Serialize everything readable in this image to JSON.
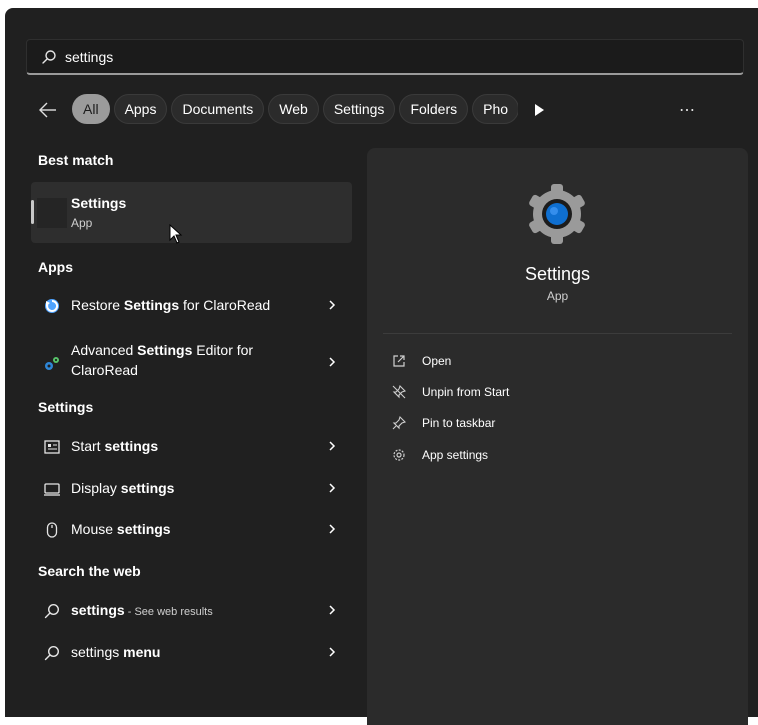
{
  "search": {
    "value": "settings"
  },
  "filters": [
    "All",
    "Apps",
    "Documents",
    "Web",
    "Settings",
    "Folders",
    "Pho"
  ],
  "sections": {
    "best_match": "Best match",
    "apps": "Apps",
    "settings": "Settings",
    "search_web": "Search the web"
  },
  "best_match": {
    "name": "Settings",
    "type": "App"
  },
  "apps": [
    {
      "pre": "Restore ",
      "bold": "Settings",
      "post": " for ClaroRead",
      "icon": "restore-icon"
    },
    {
      "pre": "Advanced ",
      "bold": "Settings",
      "post": " Editor for ClaroRead",
      "icon": "advanced-settings-icon"
    }
  ],
  "settings": [
    {
      "pre": "Start ",
      "bold": "settings",
      "icon": "start-icon"
    },
    {
      "pre": "Display ",
      "bold": "settings",
      "icon": "display-icon"
    },
    {
      "pre": "Mouse ",
      "bold": "settings",
      "icon": "mouse-icon"
    }
  ],
  "web": [
    {
      "bold": "settings",
      "small": " - See web results",
      "icon": "search-icon"
    },
    {
      "pre": "settings ",
      "bold": "menu",
      "icon": "search-icon"
    }
  ],
  "detail": {
    "title": "Settings",
    "subtitle": "App",
    "actions": [
      "Open",
      "Unpin from Start",
      "Pin to taskbar",
      "App settings"
    ]
  },
  "colors": {
    "panel": "#202020",
    "detail": "#2b2b2b",
    "accent": "#0067c0"
  }
}
